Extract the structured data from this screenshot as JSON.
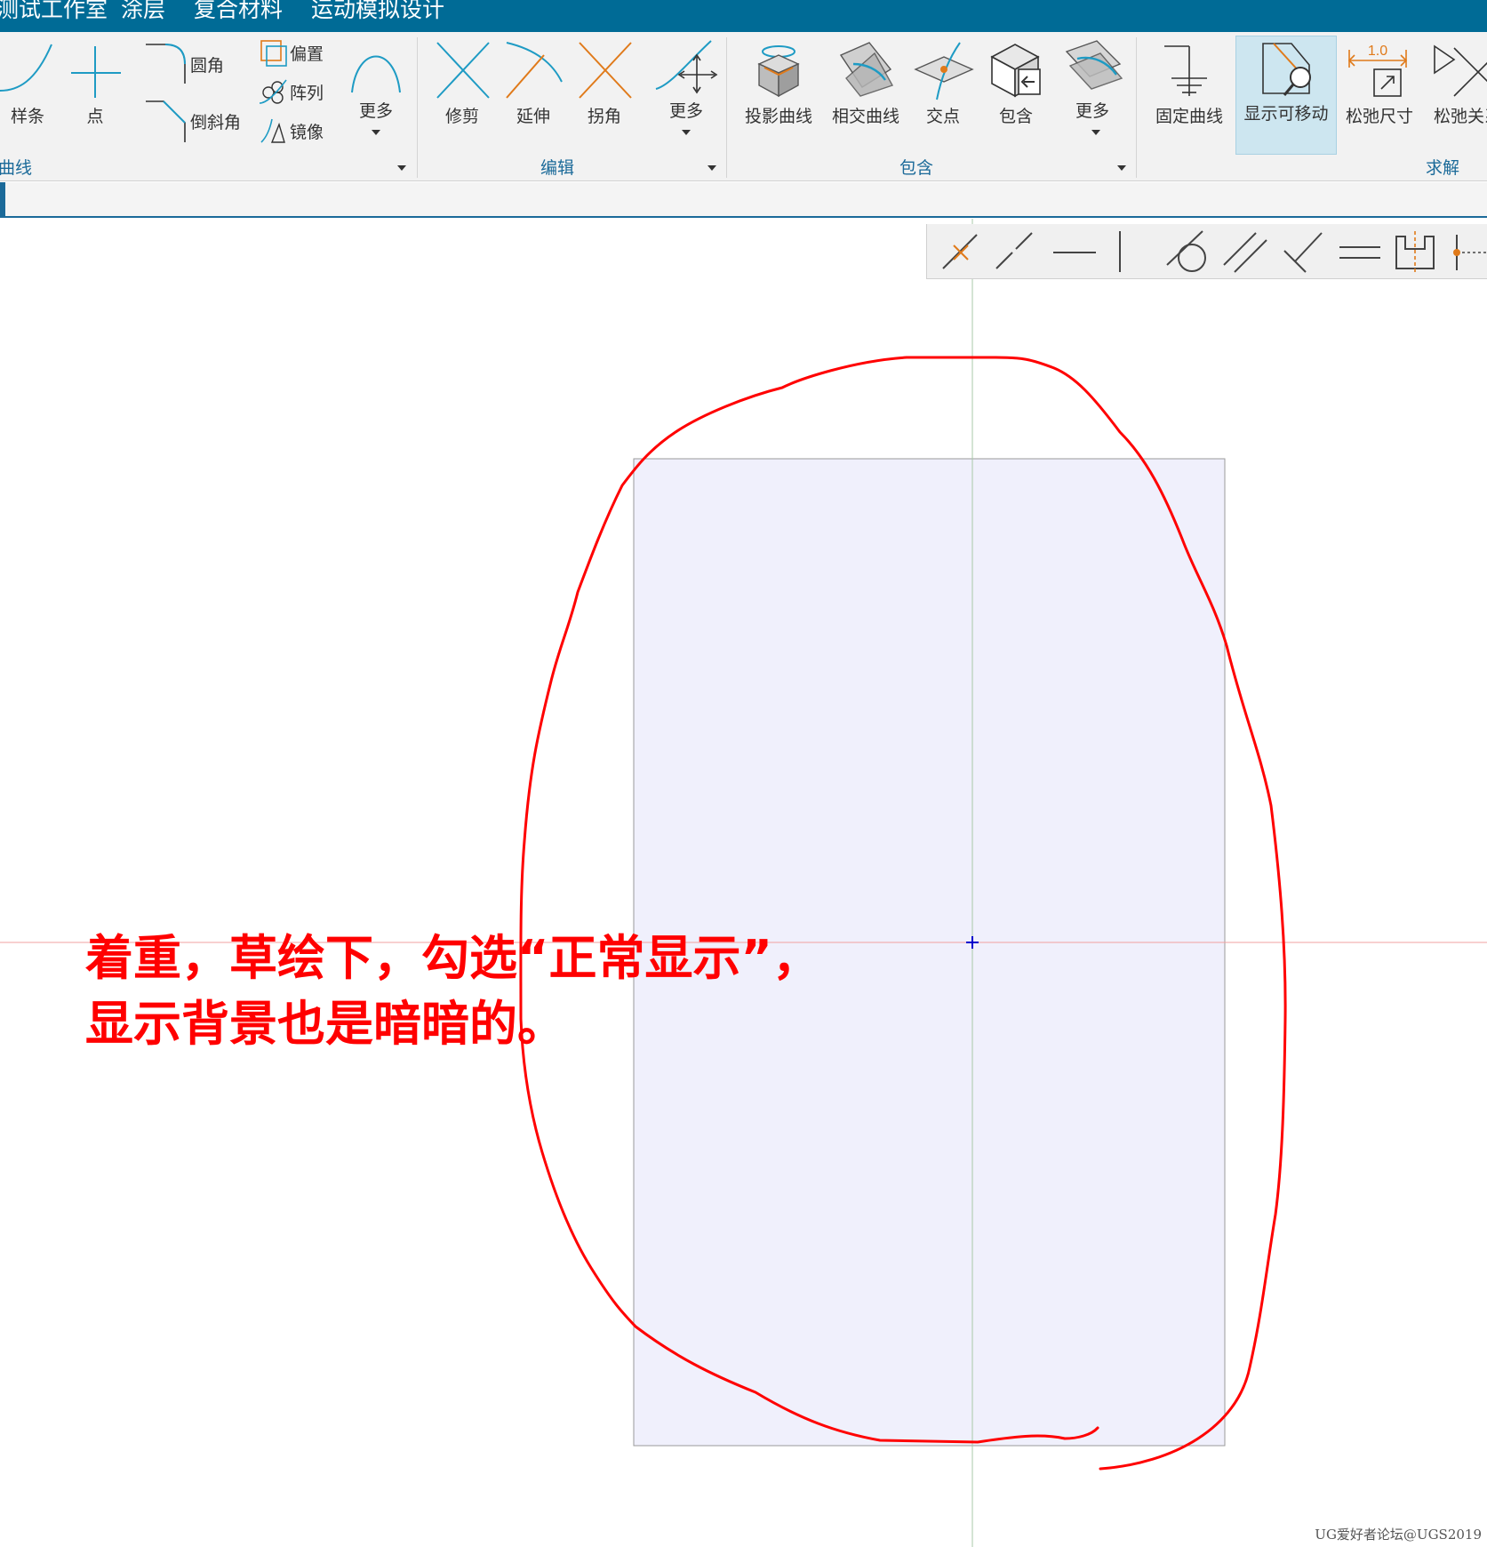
{
  "menubar": {
    "items": [
      "测试工作室",
      "涂层",
      "复合材料",
      "运动模拟设计"
    ]
  },
  "ribbon": {
    "curve_group": {
      "label": "曲线",
      "spline": "样条",
      "point": "点",
      "fillet": "圆角",
      "chamfer": "倒斜角",
      "offset": "偏置",
      "pattern": "阵列",
      "mirror": "镜像",
      "more": "更多"
    },
    "edit_group": {
      "label": "编辑",
      "trim": "修剪",
      "extend": "延伸",
      "corner": "拐角",
      "more": "更多"
    },
    "include_group": {
      "label": "包含",
      "project_curve": "投影曲线",
      "intersect_curve": "相交曲线",
      "intersect_point": "交点",
      "include": "包含",
      "more": "更多"
    },
    "solve_group": {
      "label": "求解",
      "fix_curve": "固定曲线",
      "show_movable": "显示可移动",
      "relax_dimension": "松弛尺寸",
      "relax_relation": "松弛关系",
      "dim_value": "1.0"
    }
  },
  "annotation": {
    "line1": "着重，草绘下，勾选“正常显示”，",
    "line2": "显示背景也是暗暗的。"
  },
  "watermark": "UG爱好者论坛@UGS2019",
  "colors": {
    "title_bar": "#006b96",
    "accent": "#1b6a99",
    "icon_cyan": "#1e9bc4",
    "icon_orange": "#e07a1a",
    "sketch_plane": "#f0f0fc",
    "annotation": "#ff0000",
    "x_axis": "#f2a0a0",
    "y_axis": "#a8c8a8",
    "origin_marker": "#0000cc"
  }
}
